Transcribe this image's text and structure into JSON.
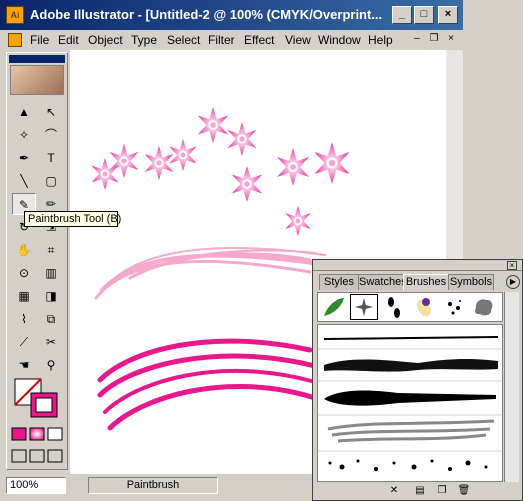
{
  "window": {
    "title": "Adobe Illustrator - [Untitled-2 @ 100% (CMYK/Overprint...",
    "minimize": "_",
    "maximize": "□",
    "close": "×"
  },
  "menubar": {
    "items": [
      "File",
      "Edit",
      "Object",
      "Type",
      "Select",
      "Filter",
      "Effect",
      "View",
      "Window",
      "Help"
    ],
    "doc_minimize": "–",
    "doc_restore": "❐",
    "doc_close": "×"
  },
  "tooltip": "Paintbrush Tool (B)",
  "toolbox": {
    "tools": [
      {
        "name": "selection-tool",
        "glyph": "▲"
      },
      {
        "name": "direct-selection-tool",
        "glyph": "↖"
      },
      {
        "name": "magic-wand-tool",
        "glyph": "✧"
      },
      {
        "name": "lasso-tool",
        "glyph": "⌒"
      },
      {
        "name": "pen-tool",
        "glyph": "✒"
      },
      {
        "name": "type-tool",
        "glyph": "T"
      },
      {
        "name": "line-tool",
        "glyph": "╲"
      },
      {
        "name": "rectangle-tool",
        "glyph": "▢"
      },
      {
        "name": "paintbrush-tool",
        "glyph": "✎"
      },
      {
        "name": "pencil-tool",
        "glyph": "✏"
      },
      {
        "name": "rotate-tool",
        "glyph": "↻"
      },
      {
        "name": "scale-tool",
        "glyph": "⇲"
      },
      {
        "name": "warp-tool",
        "glyph": "✋"
      },
      {
        "name": "free-transform-tool",
        "glyph": "⌗"
      },
      {
        "name": "symbol-sprayer-tool",
        "glyph": "⊙"
      },
      {
        "name": "column-graph-tool",
        "glyph": "▥"
      },
      {
        "name": "mesh-tool",
        "glyph": "▦"
      },
      {
        "name": "gradient-tool",
        "glyph": "◨"
      },
      {
        "name": "eyedropper-tool",
        "glyph": "⌇"
      },
      {
        "name": "blend-tool",
        "glyph": "⧉"
      },
      {
        "name": "slice-tool",
        "glyph": "⟋"
      },
      {
        "name": "scissors-tool",
        "glyph": "✂"
      },
      {
        "name": "hand-tool",
        "glyph": "☚"
      },
      {
        "name": "zoom-tool",
        "glyph": "⚲"
      }
    ]
  },
  "status": {
    "zoom": "100%",
    "current_tool": "Paintbrush"
  },
  "panel": {
    "tabs": [
      "Styles",
      "Swatches",
      "Brushes",
      "Symbols"
    ],
    "active_tab": "Brushes",
    "close": "×",
    "menu": "▶"
  },
  "colors": {
    "accent_pink": "#e8188c",
    "light_pink": "#f4a8cc",
    "title_dark": "#0a246a",
    "title_light": "#3a6ea5"
  }
}
